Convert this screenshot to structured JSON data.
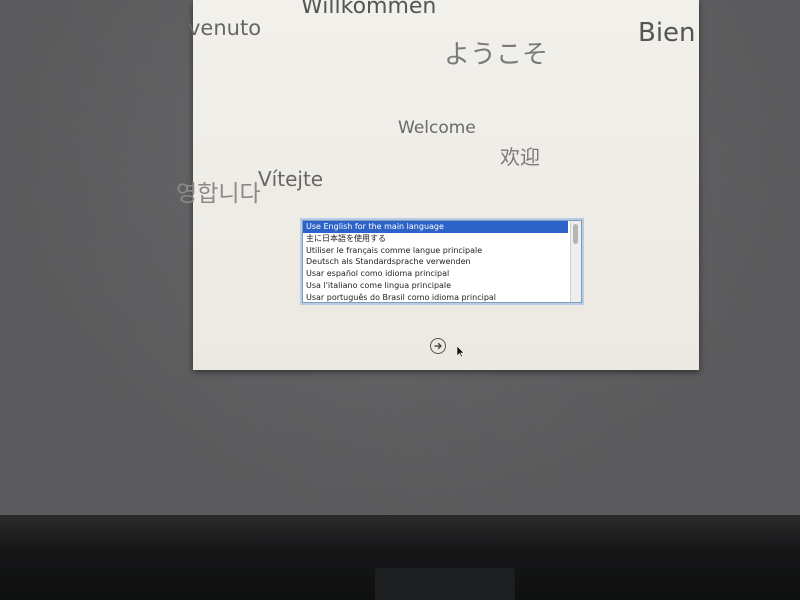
{
  "greetings": {
    "willkommen": "Willkommen",
    "benvenuto": "venuto",
    "bien": "Bien",
    "youkoso": "ようこそ",
    "welcome": "Welcome",
    "huanying": "欢迎",
    "vitejte": "Vítejte",
    "korean": "영합니다"
  },
  "language_list": {
    "items": [
      {
        "label": "Use English for the main language",
        "selected": true
      },
      {
        "label": "主に日本語を使用する",
        "selected": false
      },
      {
        "label": "Utiliser le français comme langue principale",
        "selected": false
      },
      {
        "label": "Deutsch als Standardsprache verwenden",
        "selected": false
      },
      {
        "label": "Usar español como idioma principal",
        "selected": false
      },
      {
        "label": "Usa l'italiano come lingua principale",
        "selected": false
      },
      {
        "label": "Usar português do Brasil como idioma principal",
        "selected": false
      }
    ]
  },
  "continue_button": {
    "icon": "arrow-right-circle-icon"
  },
  "colors": {
    "selection": "#2d63c8",
    "panel": "#f2f0eb",
    "desktop": "#59595b"
  }
}
